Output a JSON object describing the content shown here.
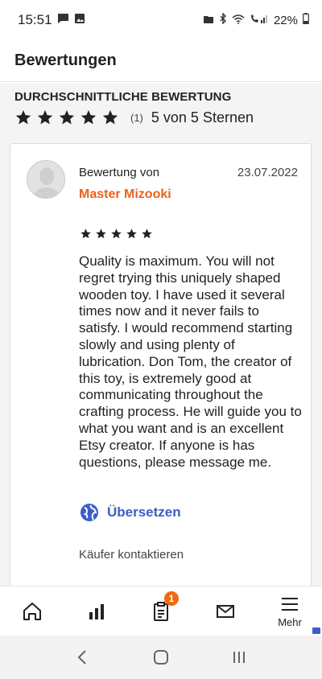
{
  "status_bar": {
    "time": "15:51",
    "battery": "22%"
  },
  "header": {
    "title": "Bewertungen"
  },
  "average": {
    "label": "DURCHSCHNITTLICHE BEWERTUNG",
    "rating": 5,
    "count": "(1)",
    "text": "5 von 5 Sternen"
  },
  "review": {
    "by_label": "Bewertung von",
    "reviewer": "Master Mizooki",
    "date": "23.07.2022",
    "rating": 5,
    "text": "Quality is maximum. You will not regret trying this uniquely shaped wooden toy. I have used it several times now and it never fails to satisfy. I would recommend starting slowly and using plenty of lubrication. Don Tom, the creator of this toy, is extremely good at communicating throughout the crafting process. He will guide you to what you want and is an excellent Etsy creator. If anyone is has questions, please message me.",
    "translate_label": "Übersetzen",
    "contact_label": "Käufer kontaktieren"
  },
  "bottom_nav": {
    "items": [
      {
        "icon": "home-icon"
      },
      {
        "icon": "stats-icon"
      },
      {
        "icon": "orders-icon",
        "badge": "1"
      },
      {
        "icon": "messages-icon"
      },
      {
        "icon": "menu-icon",
        "label": "Mehr"
      }
    ]
  },
  "colors": {
    "accent": "#e8621f",
    "link": "#3b5ec9",
    "badge": "#f06a13"
  }
}
